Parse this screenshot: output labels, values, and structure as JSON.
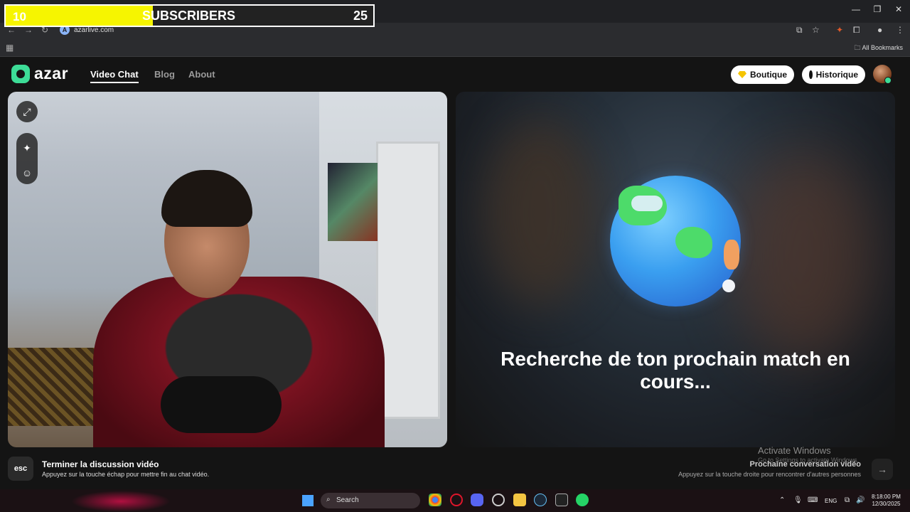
{
  "browser": {
    "url": "azarlive.com",
    "favicon_letter": "A",
    "bookmarks_label": "All Bookmarks"
  },
  "overlay": {
    "left_value": "10",
    "label": "SUBSCRIBERS",
    "right_value": "25",
    "progress": 0.4
  },
  "header": {
    "logo": "azar",
    "nav": [
      "Video Chat",
      "Blog",
      "About"
    ],
    "boutique_label": "Boutique",
    "historique_label": "Historique",
    "avatar_badge": "0"
  },
  "match": {
    "searching_text": "Recherche de ton prochain match en cours..."
  },
  "hints": {
    "esc_key": "esc",
    "end_title": "Terminer la discussion vidéo",
    "end_desc": "Appuyez sur la touche échap pour mettre fin au chat vidéo.",
    "next_title": "Prochaine conversation vidéo",
    "next_desc": "Appuyez sur la touche droite pour rencontrer d'autres personnes",
    "next_arrow": "→"
  },
  "watermark": {
    "line1": "Activate Windows",
    "line2": "Go to Settings to activate Windows."
  },
  "taskbar": {
    "search_label": "Search",
    "lang": "ENG",
    "time": "8:18:00 PM",
    "date": "12/30/2025"
  },
  "colors": {
    "brand": "#3ddc97",
    "overlay_fill": "#f6f500",
    "page_bg": "#141414"
  }
}
